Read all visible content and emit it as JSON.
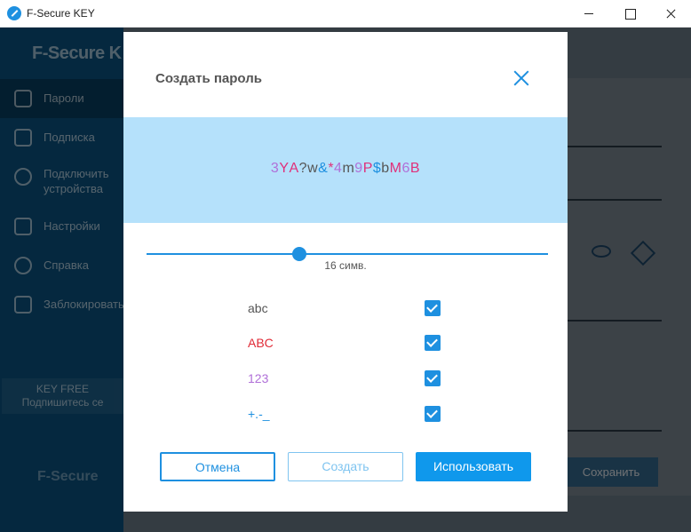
{
  "window": {
    "title": "F-Secure KEY"
  },
  "app": {
    "brand": "F-Secure K",
    "nav": [
      {
        "label": "Пароли",
        "icon": "key-icon"
      },
      {
        "label": "Подписка",
        "icon": "certificate-icon"
      },
      {
        "label": "Подключить устройства",
        "icon": "cloud-sync-icon"
      },
      {
        "label": "Настройки",
        "icon": "sliders-icon"
      },
      {
        "label": "Справка",
        "icon": "help-icon"
      },
      {
        "label": "Заблокировать",
        "icon": "logout-icon"
      }
    ],
    "promo": {
      "line1": "KEY FREE",
      "line2": "Подпишитесь се"
    },
    "brand_bottom": "F-Secure",
    "save_label": "Сохранить"
  },
  "dialog": {
    "title": "Создать пароль",
    "password_chars": [
      {
        "ch": "3",
        "kind": "digit"
      },
      {
        "ch": "Y",
        "kind": "upper"
      },
      {
        "ch": "A",
        "kind": "upper"
      },
      {
        "ch": "?",
        "kind": "lower"
      },
      {
        "ch": "w",
        "kind": "lower"
      },
      {
        "ch": "&",
        "kind": "special"
      },
      {
        "ch": "*",
        "kind": "upper"
      },
      {
        "ch": "4",
        "kind": "digit"
      },
      {
        "ch": "m",
        "kind": "lower"
      },
      {
        "ch": "9",
        "kind": "digit"
      },
      {
        "ch": "P",
        "kind": "upper"
      },
      {
        "ch": "$",
        "kind": "special"
      },
      {
        "ch": "b",
        "kind": "lower"
      },
      {
        "ch": "M",
        "kind": "upper"
      },
      {
        "ch": "6",
        "kind": "digit"
      },
      {
        "ch": "B",
        "kind": "upper"
      }
    ],
    "length_label": "16 симв.",
    "length_fraction": 0.38,
    "options": [
      {
        "label": "abc",
        "checked": true
      },
      {
        "label": "ABC",
        "checked": true
      },
      {
        "label": "123",
        "checked": true
      },
      {
        "label": "+.-_",
        "checked": true
      }
    ],
    "buttons": {
      "cancel": "Отмена",
      "create": "Создать",
      "use": "Использовать"
    }
  }
}
